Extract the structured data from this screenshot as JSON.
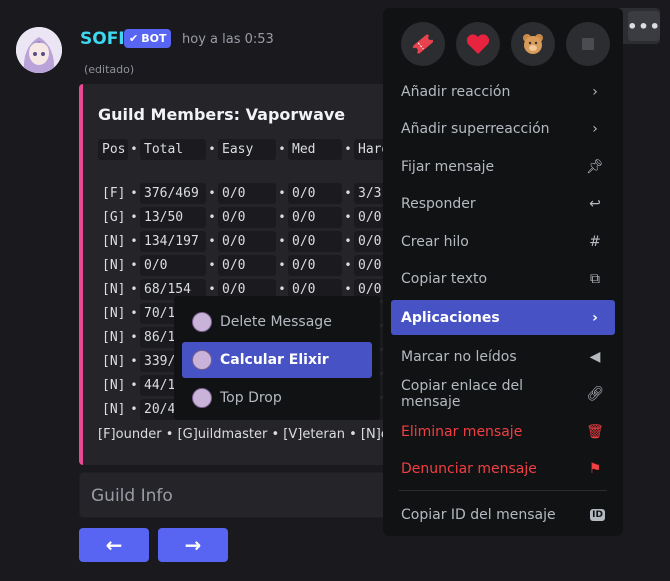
{
  "message": {
    "username": "SOFI",
    "bot_badge": "BOT",
    "timestamp": "hoy a las 0:53",
    "edited": "(editado)"
  },
  "embed": {
    "title": "Guild Members: Vaporwave",
    "headers": [
      "Pos",
      "Total",
      "Easy",
      "Med",
      "Hard"
    ],
    "rows": [
      [
        "[F]",
        "376/469",
        "0/0",
        "0/0",
        "3/3"
      ],
      [
        "[G]",
        "13/50",
        "0/0",
        "0/0",
        "0/0"
      ],
      [
        "[N]",
        "134/197",
        "0/0",
        "0/0",
        "0/0"
      ],
      [
        "[N]",
        "0/0",
        "0/0",
        "0/0",
        "0/0"
      ],
      [
        "[N]",
        "68/154",
        "0/0",
        "0/0",
        "0/0"
      ],
      [
        "[N]",
        "70/1",
        "",
        "",
        ""
      ],
      [
        "[N]",
        "86/1",
        "",
        "",
        ""
      ],
      [
        "[N]",
        "339/",
        "",
        "",
        ""
      ],
      [
        "[N]",
        "44/1",
        "",
        "",
        ""
      ],
      [
        "[N]",
        "20/4",
        "",
        "",
        ""
      ]
    ],
    "legend": "[F]ounder • [G]uildmaster • [V]eteran • [N]ewb"
  },
  "select_menu": {
    "placeholder": "Guild Info"
  },
  "nav": {
    "prev": "←",
    "next": "→"
  },
  "hover_bar": {
    "more": "•••"
  },
  "apps_submenu": {
    "items": [
      "Delete Message",
      "Calcular Elixir",
      "Top Drop"
    ]
  },
  "context_menu": {
    "items": [
      {
        "label": "Añadir reacción",
        "icon": "chevron-right"
      },
      {
        "label": "Añadir superreacción",
        "icon": "chevron-right"
      },
      {
        "label": "Fijar mensaje",
        "icon": "pin"
      },
      {
        "label": "Responder",
        "icon": "reply"
      },
      {
        "label": "Crear hilo",
        "icon": "thread"
      },
      {
        "label": "Copiar texto",
        "icon": "copy"
      },
      {
        "label": "Aplicaciones",
        "icon": "chevron-right"
      },
      {
        "label": "Marcar no leídos",
        "icon": "unread"
      },
      {
        "label": "Copiar enlace del mensaje",
        "icon": "link"
      },
      {
        "label": "Eliminar mensaje",
        "icon": "trash"
      },
      {
        "label": "Denunciar mensaje",
        "icon": "flag"
      },
      {
        "label": "Copiar ID del mensaje",
        "icon": "id"
      }
    ]
  },
  "colors": {
    "accent": "#5865f2",
    "embed_border": "#e84a94",
    "danger": "#f23f43",
    "username": "#3ed8f0"
  }
}
